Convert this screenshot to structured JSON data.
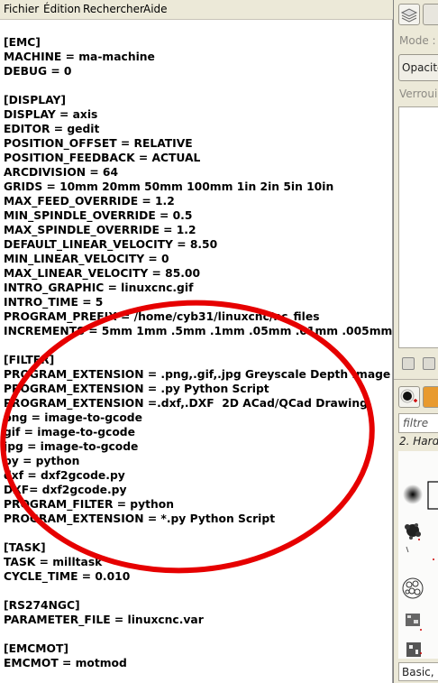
{
  "menubar": {
    "fichier": "Fichier",
    "edition": "Édition",
    "rechercher": "Rechercher",
    "aide": "Aide"
  },
  "editor": {
    "lines": [
      "[EMC]",
      "MACHINE = ma-machine",
      "DEBUG = 0",
      "",
      "[DISPLAY]",
      "DISPLAY = axis",
      "EDITOR = gedit",
      "POSITION_OFFSET = RELATIVE",
      "POSITION_FEEDBACK = ACTUAL",
      "ARCDIVISION = 64",
      "GRIDS = 10mm 20mm 50mm 100mm 1in 2in 5in 10in",
      "MAX_FEED_OVERRIDE = 1.2",
      "MIN_SPINDLE_OVERRIDE = 0.5",
      "MAX_SPINDLE_OVERRIDE = 1.2",
      "DEFAULT_LINEAR_VELOCITY = 8.50",
      "MIN_LINEAR_VELOCITY = 0",
      "MAX_LINEAR_VELOCITY = 85.00",
      "INTRO_GRAPHIC = linuxcnc.gif",
      "INTRO_TIME = 5",
      "PROGRAM_PREFIX = /home/cyb31/linuxcnc/nc_files",
      "INCREMENTS = 5mm 1mm .5mm .1mm .05mm .01mm .005mm",
      "",
      "[FILTER]",
      "PROGRAM_EXTENSION = .png,.gif,.jpg Greyscale Depth Image",
      "PROGRAM_EXTENSION = .py Python Script",
      "PROGRAM_EXTENSION =.dxf,.DXF  2D ACad/QCad Drawing",
      "png = image-to-gcode",
      "gif = image-to-gcode",
      "jpg = image-to-gcode",
      "py = python",
      "dxf = dxf2gcode.py",
      "DXF= dxf2gcode.py",
      "PROGRAM_FILTER = python",
      "PROGRAM_EXTENSION = *.py Python Script",
      "",
      "[TASK]",
      "TASK = milltask",
      "CYCLE_TIME = 0.010",
      "",
      "[RS274NGC]",
      "PARAMETER_FILE = linuxcnc.var",
      "",
      "[EMCMOT]",
      "EMCMOT = motmod"
    ]
  },
  "dock": {
    "mode_label": "Mode :",
    "opacity_button": "Opacité",
    "lock_label": "Verrouil",
    "filter_placeholder": "filtre",
    "brush_category": "2. Hardn",
    "bottom_select": "Basic,"
  },
  "colors": {
    "annotation_ellipse": "#e60000",
    "menubar_bg": "#ece9d8",
    "dock_bg": "#ece9d8",
    "editor_bg": "#ffffff"
  }
}
